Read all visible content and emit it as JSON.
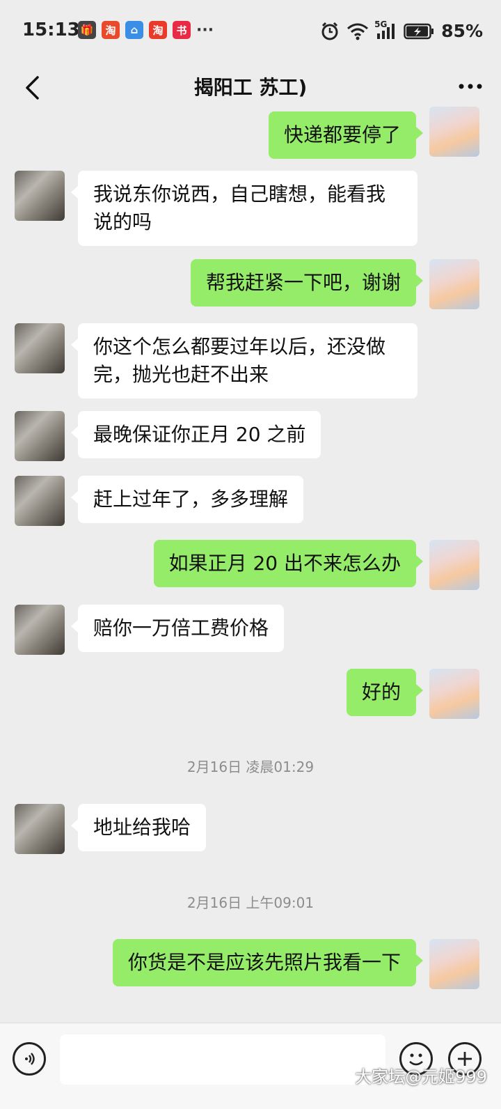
{
  "status_bar": {
    "time": "15:13",
    "app_icons": [
      {
        "name": "gift-icon",
        "glyph": "🎁",
        "color": "#444444"
      },
      {
        "name": "taobao-discount-icon",
        "glyph": "淘",
        "color": "#e84a2b"
      },
      {
        "name": "store-bag-icon",
        "glyph": "⌂",
        "color": "#3a8ee6"
      },
      {
        "name": "taobao-icon",
        "glyph": "淘",
        "color": "#ea3b2a"
      },
      {
        "name": "xiaohongshu-icon",
        "glyph": "书",
        "color": "#ea2a44"
      }
    ],
    "more_dots": "···",
    "network": "5G",
    "battery": "85%"
  },
  "header": {
    "title": "揭阳工 苏工)"
  },
  "messages": [
    {
      "from": "me",
      "text": "快递都要停了"
    },
    {
      "from": "them",
      "text": "我说东你说西，自己瞎想，能看我说的吗"
    },
    {
      "from": "me",
      "text": "帮我赶紧一下吧，谢谢"
    },
    {
      "from": "them",
      "text": "你这个怎么都要过年以后，还没做完，抛光也赶不出来"
    },
    {
      "from": "them",
      "text": "最晚保证你正月 20 之前"
    },
    {
      "from": "them",
      "text": "赶上过年了，多多理解"
    },
    {
      "from": "me",
      "text": "如果正月 20 出不来怎么办"
    },
    {
      "from": "them",
      "text": "赔你一万倍工费价格"
    },
    {
      "from": "me",
      "text": "好的"
    },
    {
      "from": "them",
      "text": "地址给我哈"
    },
    {
      "from": "me",
      "text": "你货是不是应该先照片我看一下"
    }
  ],
  "timestamps": [
    "2月16日 凌晨01:29",
    "2月16日 上午09:01"
  ],
  "input_bar": {
    "value": "",
    "placeholder": ""
  },
  "watermark": "大家坛@元姬999"
}
